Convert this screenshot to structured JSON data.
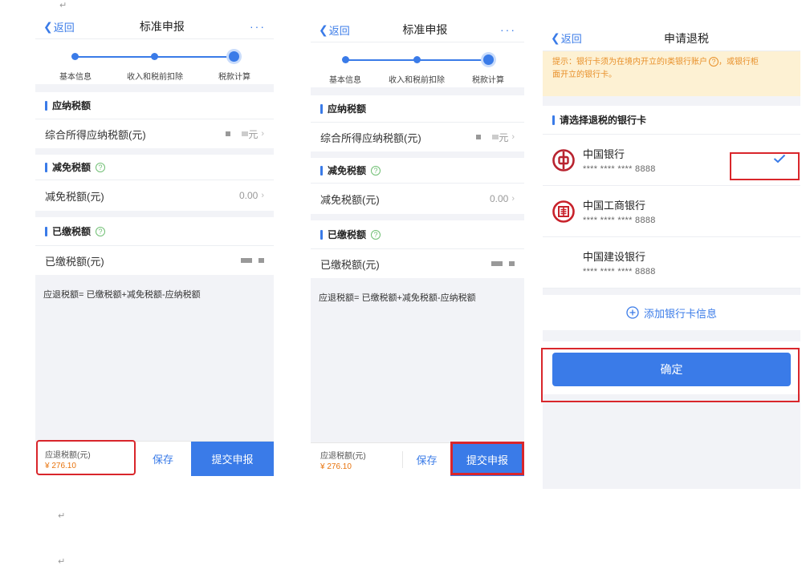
{
  "colors": {
    "accent": "#3a7be8",
    "highlight": "#d9262b",
    "amount": "#e8730c",
    "tip_bg": "#fdf1d3"
  },
  "para_mark": "↵",
  "screen1": {
    "nav": {
      "back": "返回",
      "title": "标准申报",
      "more": "···"
    },
    "steps": [
      "基本信息",
      "收入和税前扣除",
      "税款计算"
    ],
    "sections": {
      "payable": "应纳税额",
      "payable_row": "综合所得应纳税额(元)",
      "payable_unit": "元",
      "relief": "减免税额",
      "relief_row": "减免税额(元)",
      "relief_value": "0.00",
      "paid": "已缴税额",
      "paid_row": "已缴税额(元)"
    },
    "formula": "应退税额= 已缴税额+减免税额-应纳税额",
    "bottom": {
      "due_label": "应退税额(元)",
      "due_amount": "¥ 276.10",
      "save": "保存",
      "submit": "提交申报"
    }
  },
  "screen2": {
    "nav": {
      "back": "返回",
      "title": "标准申报",
      "more": "···"
    },
    "steps": [
      "基本信息",
      "收入和税前扣除",
      "税款计算"
    ],
    "sections": {
      "payable": "应纳税额",
      "payable_row": "综合所得应纳税额(元)",
      "payable_unit": "元",
      "relief": "减免税额",
      "relief_row": "减免税额(元)",
      "relief_value": "0.00",
      "paid": "已缴税额",
      "paid_row": "已缴税额(元)"
    },
    "formula": "应退税额= 已缴税额+减免税额-应纳税额",
    "bottom": {
      "due_label": "应退税额(元)",
      "due_amount": "¥ 276.10",
      "save": "保存",
      "submit": "提交申报"
    }
  },
  "screen3": {
    "nav": {
      "back": "返回",
      "title": "申请退税"
    },
    "tip_line1": "提示：银行卡须为在境内开立的Ⅰ类银行账户",
    "tip_line1_end": "，或银行柜",
    "tip_line2": "面开立的银行卡。",
    "section_title": "请选择退税的银行卡",
    "cards": [
      {
        "name": "中国银行",
        "number": "**** **** **** 8888",
        "selected": true
      },
      {
        "name": "中国工商银行",
        "number": "**** **** **** 8888",
        "selected": false
      },
      {
        "name": "中国建设银行",
        "number": "**** **** **** 8888",
        "selected": false
      }
    ],
    "add_card": "添加银行卡信息",
    "confirm": "确定"
  }
}
